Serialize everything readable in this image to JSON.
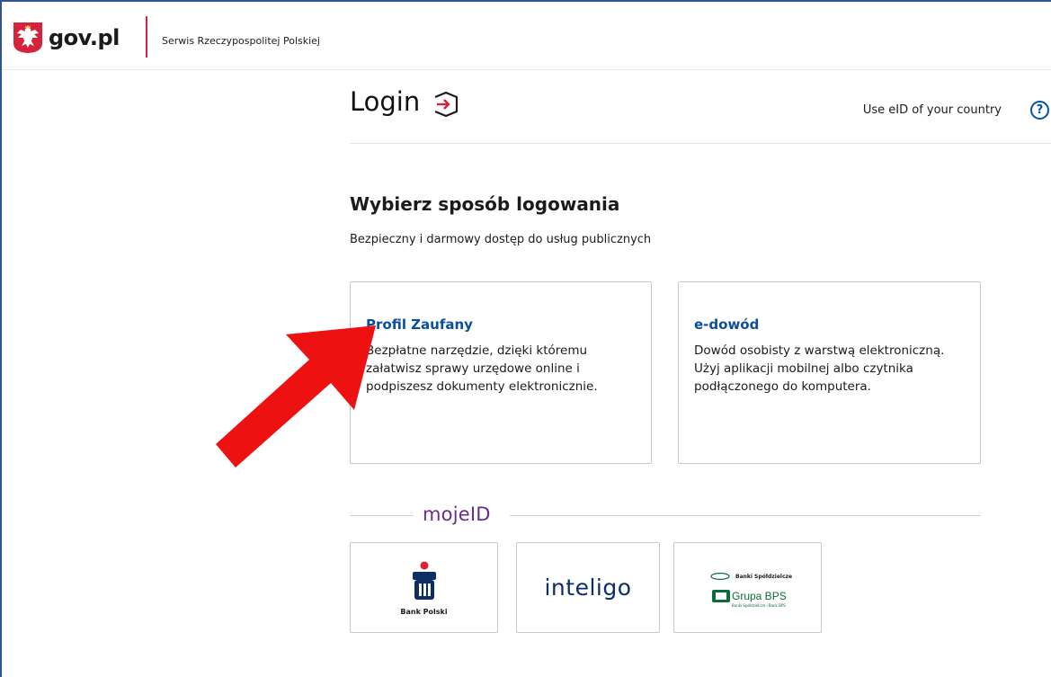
{
  "header": {
    "logo_text": "gov.pl",
    "service_name": "Serwis Rzeczypospolitej Polskiej"
  },
  "login": {
    "title": "Login",
    "eid_link": "Use eID of your country",
    "help_symbol": "?"
  },
  "main": {
    "heading": "Wybierz sposób logowania",
    "subheading": "Bezpieczny i darmowy dostęp do usług publicznych",
    "cards": [
      {
        "title": "Profil Zaufany",
        "description": "Bezpłatne narzędzie, dzięki któremu załatwisz sprawy urzędowe online i podpiszesz dokumenty elektronicznie."
      },
      {
        "title": "e-dowód",
        "description": "Dowód osobisty z warstwą elektroniczną. Użyj aplikacji mobilnej albo czytnika podłączonego do komputera."
      }
    ]
  },
  "mojeid": {
    "label": "mojeID",
    "banks": [
      {
        "name": "Bank Polski",
        "icon": "pko-bank-polski-logo"
      },
      {
        "name": "inteligo",
        "icon": "inteligo-logo"
      },
      {
        "name": "Grupa BPS",
        "top_text": "Banki Spółdzielcze",
        "small_text": "Banki Spółdzielcze i Bank BPS",
        "icon": "grupa-bps-logo"
      }
    ]
  },
  "colors": {
    "accent_red": "#d5233b",
    "link_blue": "#0b4e9a",
    "mojeid_purple": "#6b2c8a",
    "annotation_arrow": "#ee1111"
  }
}
